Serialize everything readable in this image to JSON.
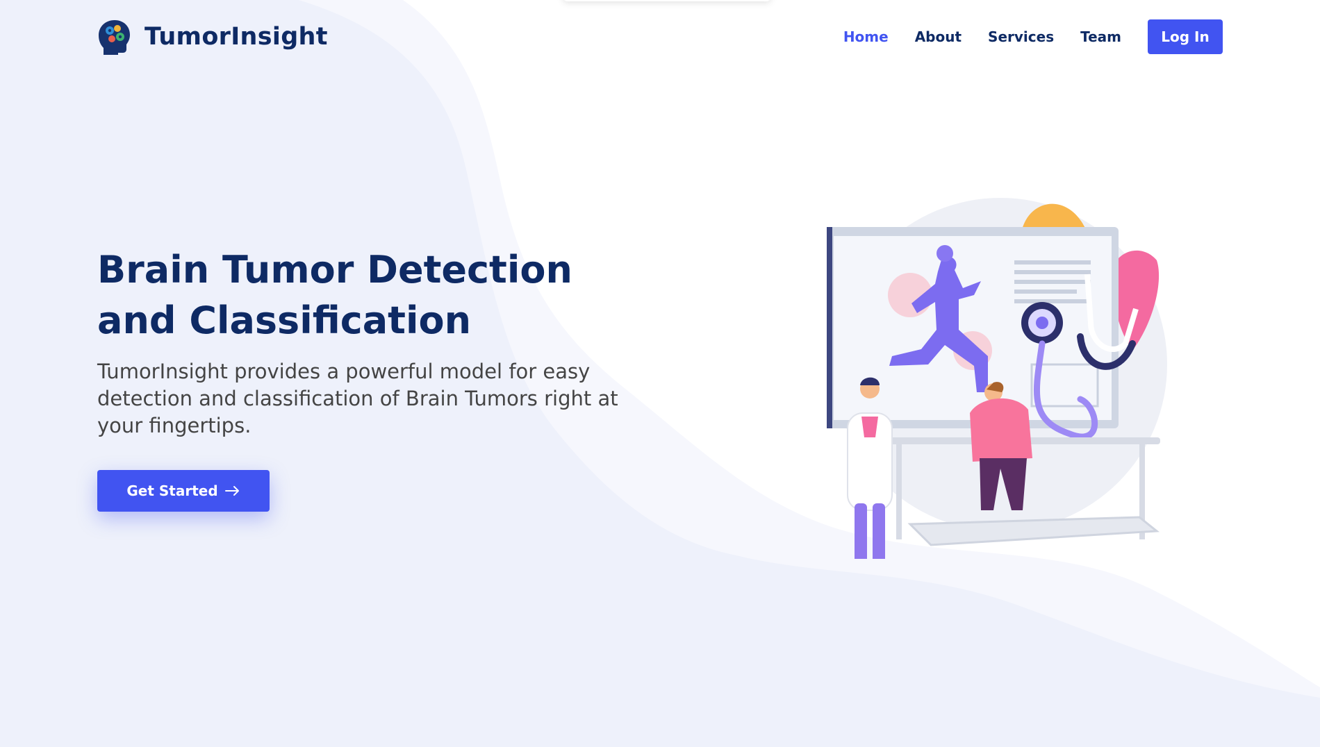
{
  "brand": {
    "name": "TumorInsight",
    "logo_icon": "brain-head-icon"
  },
  "nav": {
    "items": [
      {
        "label": "Home",
        "active": true
      },
      {
        "label": "About",
        "active": false
      },
      {
        "label": "Services",
        "active": false
      },
      {
        "label": "Team",
        "active": false
      }
    ],
    "login_label": "Log In"
  },
  "hero": {
    "title": "Brain Tumor Detection and Classification",
    "subtitle": "TumorInsight provides a powerful model for easy detection and classification of Brain Tumors right at your fingertips.",
    "cta_label": "Get Started",
    "cta_icon": "arrow-right-icon"
  },
  "illustration": {
    "icon": "medical-checkup-illustration"
  },
  "colors": {
    "accent": "#4154f1",
    "heading": "#0e2a64",
    "background": "#eef1fb",
    "body_text": "#444444"
  }
}
